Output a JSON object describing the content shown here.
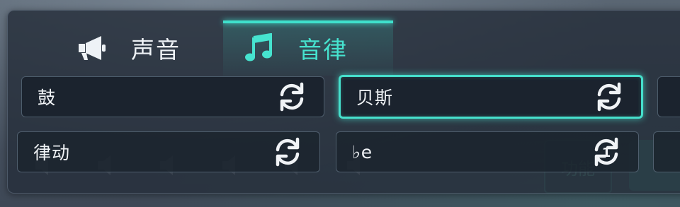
{
  "tabs": [
    {
      "label": "声音",
      "icon": "megaphone-icon",
      "active": false
    },
    {
      "label": "音律",
      "icon": "music-note-icon",
      "active": true
    }
  ],
  "slots": [
    {
      "label": "鼓",
      "icon": "refresh-icon",
      "selected": false
    },
    {
      "label": "贝斯",
      "icon": "refresh-icon",
      "selected": true
    },
    {
      "label": "",
      "icon": "",
      "selected": false
    },
    {
      "label": "律动",
      "icon": "refresh-icon",
      "selected": false
    },
    {
      "label": "♭e",
      "icon": "refresh-one-icon",
      "badge": "1",
      "selected": false
    },
    {
      "label": "",
      "icon": "",
      "selected": false
    }
  ],
  "background": {
    "function_button_label": "功能"
  },
  "colors": {
    "accent": "#46e0cc",
    "panel": "#262e3a",
    "text": "#f0f3f6"
  }
}
